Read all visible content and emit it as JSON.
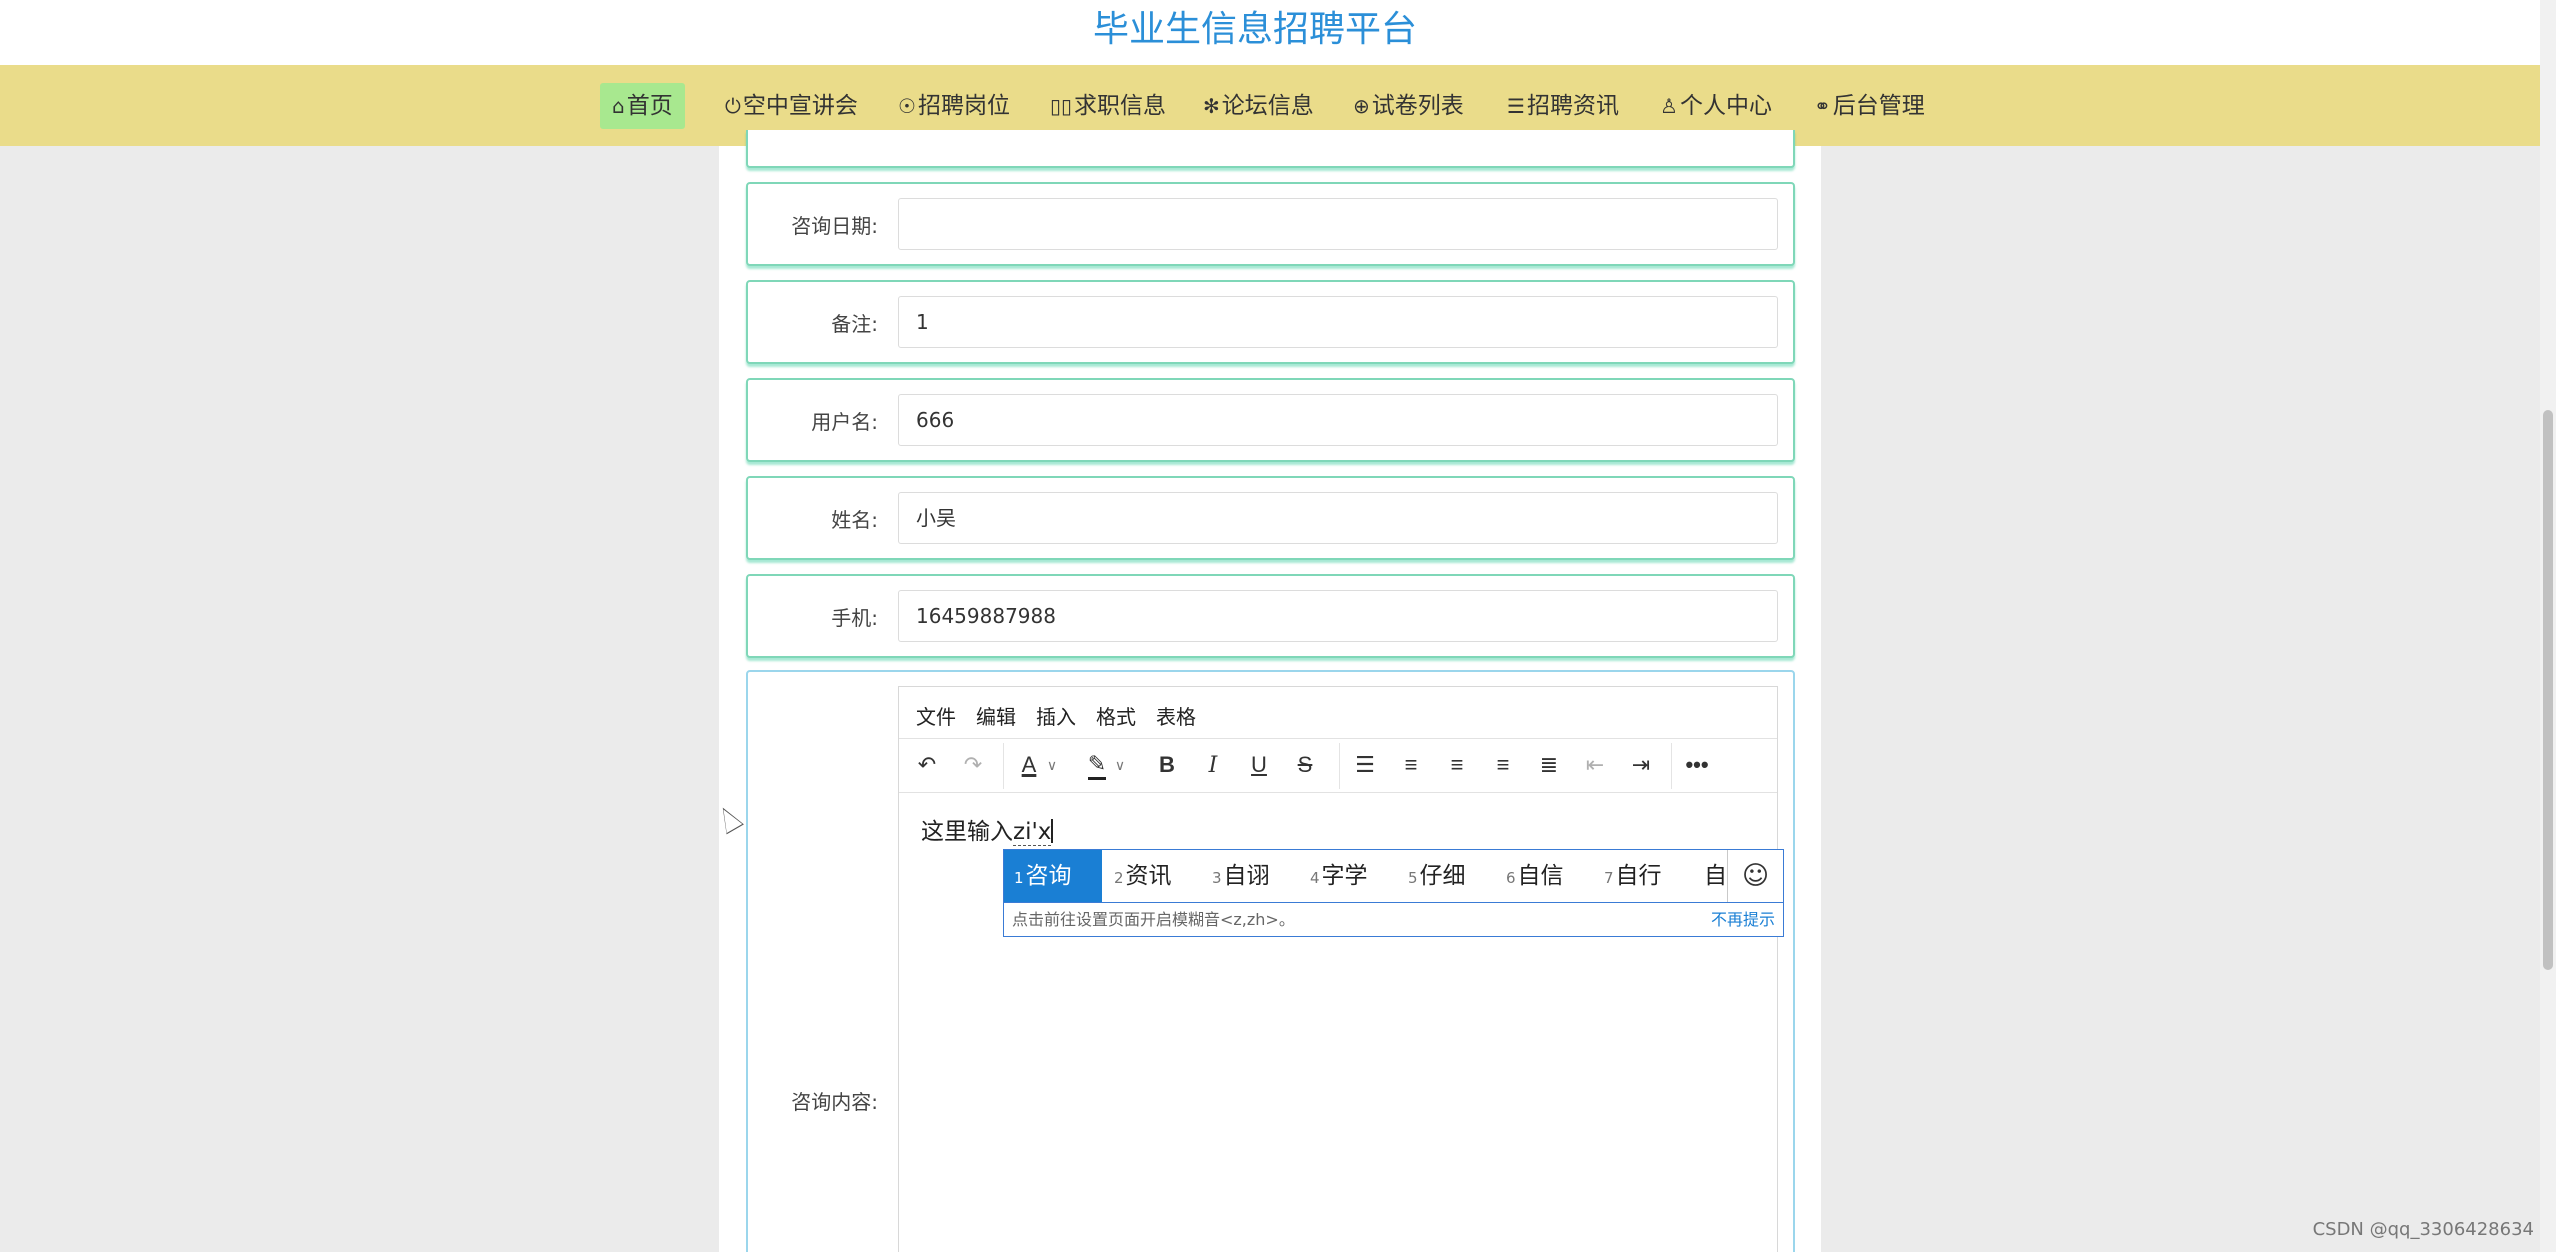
{
  "site": {
    "title": "毕业生信息招聘平台"
  },
  "nav": {
    "items": [
      {
        "icon": "⌂",
        "label": "首页"
      },
      {
        "icon": "⏻",
        "label": "空中宣讲会"
      },
      {
        "icon": "☉",
        "label": "招聘岗位"
      },
      {
        "icon": "▯▯",
        "label": "求职信息"
      },
      {
        "icon": "✻",
        "label": "论坛信息"
      },
      {
        "icon": "⊕",
        "label": "试卷列表"
      },
      {
        "icon": "☰",
        "label": "招聘资讯"
      },
      {
        "icon": "♙",
        "label": "个人中心"
      },
      {
        "icon": "⚭",
        "label": "后台管理"
      }
    ],
    "active_index": 0
  },
  "form": {
    "consult_date": {
      "label": "咨询日期:",
      "value": ""
    },
    "remark": {
      "label": "备注:",
      "value": "1"
    },
    "username": {
      "label": "用户名:",
      "value": "666"
    },
    "name": {
      "label": "姓名:",
      "value": "小吴"
    },
    "phone": {
      "label": "手机:",
      "value": "16459887988"
    },
    "content": {
      "label": "咨询内容:"
    }
  },
  "editor": {
    "menus": [
      "文件",
      "编辑",
      "插入",
      "格式",
      "表格"
    ],
    "text": "这里输入",
    "composing": "zi'x"
  },
  "ime": {
    "candidates": [
      {
        "num": "1",
        "text": "咨询"
      },
      {
        "num": "2",
        "text": "资讯"
      },
      {
        "num": "3",
        "text": "自诩"
      },
      {
        "num": "4",
        "text": "字学"
      },
      {
        "num": "5",
        "text": "仔细"
      },
      {
        "num": "6",
        "text": "自信"
      },
      {
        "num": "7",
        "text": "自行"
      },
      {
        "num": "",
        "text": "自"
      }
    ],
    "hint": "点击前往设置页面开启模糊音<z,zh>。",
    "dismiss": "不再提示",
    "emoji": "☺"
  },
  "watermark": "CSDN @qq_3306428634",
  "colors": {
    "nav_bg": "#eadc8a",
    "nav_active": "#a8e88f",
    "title": "#2b8fd8",
    "card_border": "#7fd7b8",
    "ime_selected": "#1a7fd4"
  }
}
